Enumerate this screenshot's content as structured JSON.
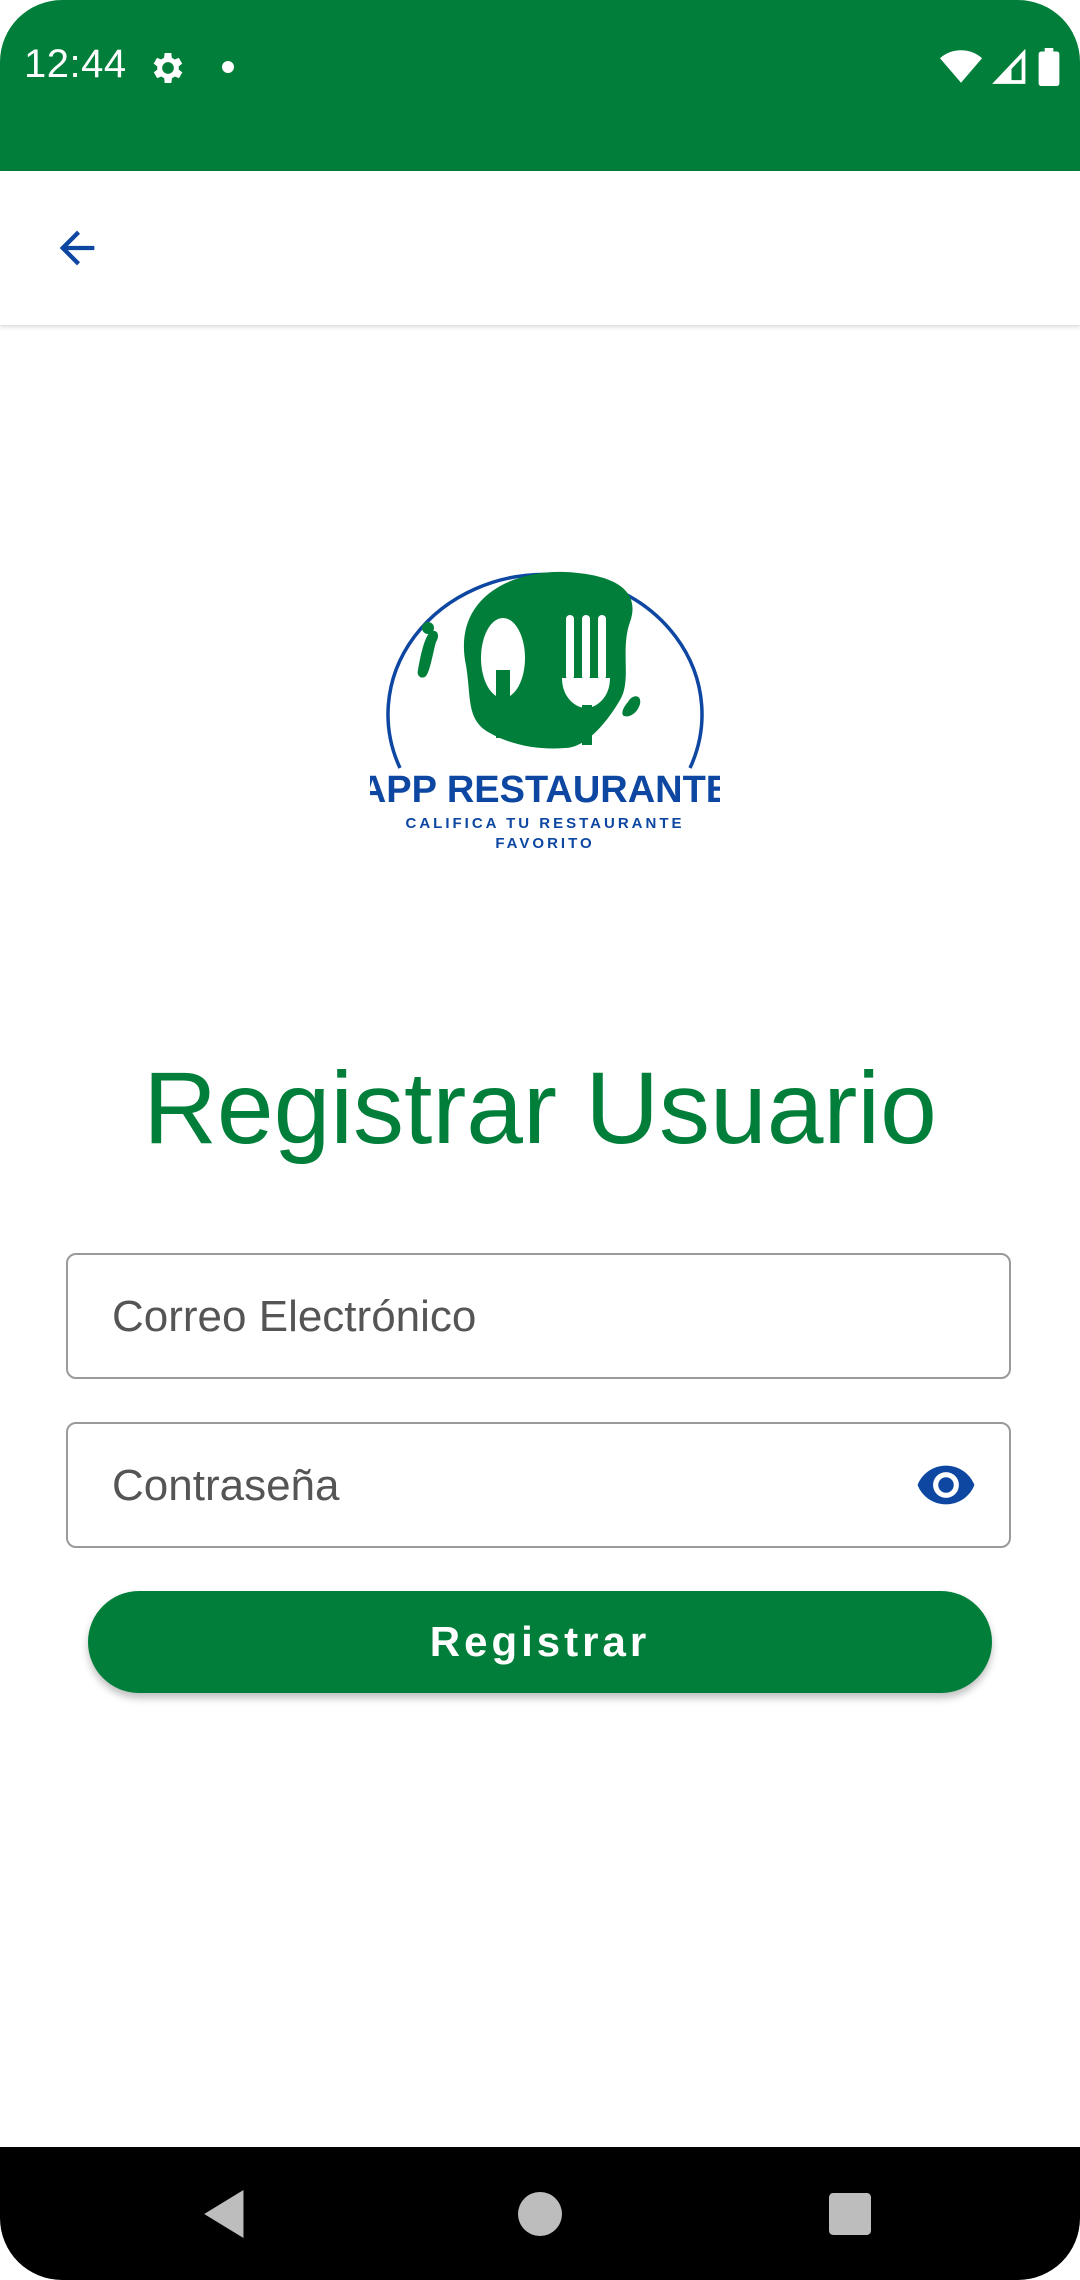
{
  "status_bar": {
    "time": "12:44",
    "icons": [
      "settings-icon",
      "notification-dot",
      "wifi-icon",
      "signal-icon",
      "battery-icon"
    ],
    "background": "#017F3A"
  },
  "app_bar": {
    "back_icon": "arrow-back-icon",
    "icon_color": "#0D47A1"
  },
  "logo": {
    "brand": "APP RESTAURANTE",
    "tagline_line1": "CALIFICA TU RESTAURANTE",
    "tagline_line2": "FAVORITO",
    "icon": "spoon-fork-icon"
  },
  "page": {
    "title": "Registrar Usuario"
  },
  "form": {
    "email_placeholder": "Correo Electrónico",
    "email_value": "",
    "password_placeholder": "Contraseña",
    "password_value": "",
    "visibility_icon": "eye-icon",
    "submit_label": "Registrar"
  },
  "nav_bar": {
    "buttons": [
      "back-triangle-icon",
      "home-circle-icon",
      "recents-square-icon"
    ]
  },
  "colors": {
    "primary_green": "#017F3A",
    "accent_blue": "#0D47A1"
  }
}
